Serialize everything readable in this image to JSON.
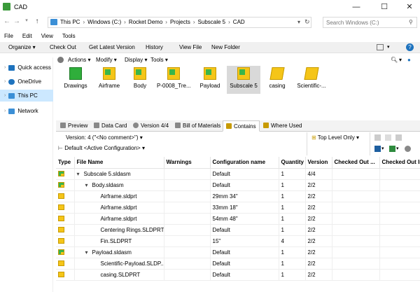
{
  "window": {
    "title": "CAD",
    "min_glyph": "—",
    "max_glyph": "☐",
    "close_glyph": "✕"
  },
  "address": {
    "crumbs": [
      "This PC",
      "Windows (C:)",
      "Rocket Demo",
      "Projects",
      "Subscale 5",
      "CAD"
    ],
    "search_placeholder": "Search Windows (C:)"
  },
  "menu": [
    "File",
    "Edit",
    "View",
    "Tools"
  ],
  "command_bar": {
    "organize": "Organize ▾",
    "check_out": "Check Out",
    "get_latest": "Get Latest Version",
    "history": "History",
    "view_file": "View File",
    "new_folder": "New Folder"
  },
  "nav": [
    {
      "label": "Quick access",
      "icon": "star-icon",
      "color": "#1e73be"
    },
    {
      "label": "OneDrive",
      "icon": "cloud-icon",
      "color": "#1e73be"
    },
    {
      "label": "This PC",
      "icon": "computer-icon",
      "color": "#3b8fd6"
    },
    {
      "label": "Network",
      "icon": "network-icon",
      "color": "#3b8fd6"
    }
  ],
  "pdm_toolbar": {
    "actions": "Actions ▾",
    "modify": "Modify ▾",
    "display": "Display ▾",
    "tools": "Tools ▾"
  },
  "files": [
    {
      "label": "Drawings",
      "type": "folder"
    },
    {
      "label": "Airframe",
      "type": "asm"
    },
    {
      "label": "Body",
      "type": "asm"
    },
    {
      "label": "P-0008_Tre...",
      "type": "asm"
    },
    {
      "label": "Payload",
      "type": "asm"
    },
    {
      "label": "Subscale 5",
      "type": "asm",
      "selected": true
    },
    {
      "label": "casing",
      "type": "part"
    },
    {
      "label": "Scientific-...",
      "type": "part"
    }
  ],
  "tabs": [
    "Preview",
    "Data Card",
    "Version 4/4",
    "Bill of Materials",
    "Contains",
    "Where Used"
  ],
  "active_tab": "Contains",
  "version_bar": {
    "version": "Version: 4 (\"<No comment>\")",
    "config": "Default <Active Configuration>",
    "level": "Top Level Only"
  },
  "table": {
    "headers": [
      "Type",
      "File Name",
      "Warnings",
      "Configuration name",
      "Quantity",
      "Version",
      "Checked Out ...",
      "Checked Out In"
    ],
    "rows": [
      {
        "type": "asm",
        "indent": 0,
        "expand": "▾",
        "name": "Subscale 5.sldasm",
        "warnings": "",
        "config": "Default",
        "qty": "1",
        "ver": "4/4"
      },
      {
        "type": "asm",
        "indent": 1,
        "expand": "▾",
        "name": "Body.sldasm",
        "warnings": "",
        "config": "Default",
        "qty": "1",
        "ver": "2/2"
      },
      {
        "type": "part",
        "indent": 2,
        "expand": "",
        "name": "Airframe.sldprt",
        "warnings": "",
        "config": "29mm 34\"",
        "qty": "1",
        "ver": "2/2"
      },
      {
        "type": "part",
        "indent": 2,
        "expand": "",
        "name": "Airframe.sldprt",
        "warnings": "",
        "config": "33mm 18\"",
        "qty": "1",
        "ver": "2/2"
      },
      {
        "type": "part",
        "indent": 2,
        "expand": "",
        "name": "Airframe.sldprt",
        "warnings": "",
        "config": "54mm 48\"",
        "qty": "1",
        "ver": "2/2"
      },
      {
        "type": "part",
        "indent": 2,
        "expand": "",
        "name": "Centering Rings.SLDPRT",
        "warnings": "",
        "config": "Default",
        "qty": "1",
        "ver": "2/2"
      },
      {
        "type": "part",
        "indent": 2,
        "expand": "",
        "name": "Fin.SLDPRT",
        "warnings": "",
        "config": "15\"",
        "qty": "4",
        "ver": "2/2"
      },
      {
        "type": "asm",
        "indent": 1,
        "expand": "▾",
        "name": "Payload.sldasm",
        "warnings": "",
        "config": "Default",
        "qty": "1",
        "ver": "2/2"
      },
      {
        "type": "part",
        "indent": 2,
        "expand": "",
        "name": "Scientific-Payload.SLDP...",
        "warnings": "",
        "config": "Default",
        "qty": "1",
        "ver": "2/2"
      },
      {
        "type": "part",
        "indent": 2,
        "expand": "",
        "name": "casing.SLDPRT",
        "warnings": "",
        "config": "Default",
        "qty": "1",
        "ver": "2/2"
      }
    ]
  }
}
